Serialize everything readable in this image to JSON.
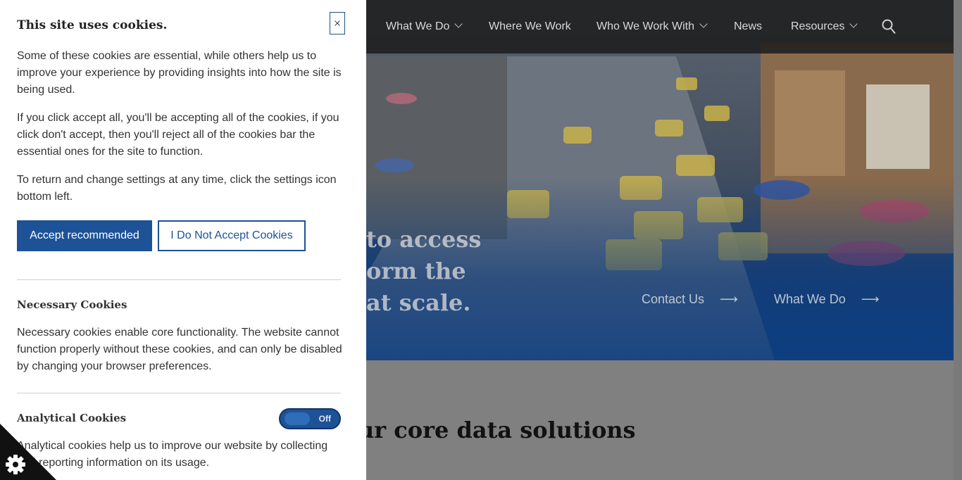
{
  "nav": {
    "items": [
      {
        "label": "What We Do",
        "dropdown": true
      },
      {
        "label": "Where We Work",
        "dropdown": false
      },
      {
        "label": "Who We Work With",
        "dropdown": true
      },
      {
        "label": "News",
        "dropdown": false
      },
      {
        "label": "Resources",
        "dropdown": true
      }
    ],
    "search_icon": "search-icon"
  },
  "hero": {
    "line1": "to access",
    "line2": "orm the",
    "line3": "at scale.",
    "links": [
      {
        "label": "Contact Us",
        "arrow": "⟶"
      },
      {
        "label": "What We Do",
        "arrow": "⟶"
      }
    ]
  },
  "section": {
    "title": "ur core data solutions"
  },
  "cookie_panel": {
    "title": "This site uses cookies.",
    "close_icon": "close-icon",
    "intro": "Some of these cookies are essential, while others help us to improve your experience by providing insights into how the site is being used.",
    "accept_info": "If you click accept all, you'll be accepting all of the cookies, if you click don't accept, then you'll reject all of the cookies bar the essential ones for the site to function.",
    "return_info": "To return and change settings at any time, click the settings icon bottom left.",
    "accept_label": "Accept recommended",
    "decline_label": "I Do Not Accept Cookies",
    "necessary": {
      "title": "Necessary Cookies",
      "text": "Necessary cookies enable core functionality. The website cannot function properly without these cookies, and can only be disabled by changing your browser preferences."
    },
    "analytical": {
      "title": "Analytical Cookies",
      "toggle_state": "Off",
      "text": "Analytical cookies help us to improve our website by collecting and reporting information on its usage."
    },
    "settings_icon": "gear-icon"
  },
  "colors": {
    "accent": "#1d5296",
    "nav_bg": "#1e1e1e",
    "hero_blue": "#143f78"
  }
}
